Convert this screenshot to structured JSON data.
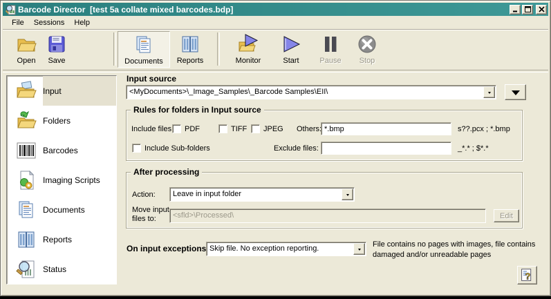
{
  "window": {
    "title": "Barcode Director  [test 5a collate mixed barcodes.bdp]",
    "app_icon": "barcode-magnifier-icon",
    "controls": {
      "minimize": "minimize-icon",
      "maximize": "maximize-icon",
      "close": "close-icon"
    }
  },
  "menu": {
    "items": [
      {
        "label": "File"
      },
      {
        "label": "Sessions"
      },
      {
        "label": "Help"
      }
    ]
  },
  "toolbar": {
    "items": [
      {
        "label": "Open",
        "icon": "open-folder-icon"
      },
      {
        "label": "Save",
        "icon": "save-floppy-icon"
      },
      {
        "label": "Documents",
        "icon": "documents-icon",
        "selected": true
      },
      {
        "label": "Reports",
        "icon": "reports-icon"
      },
      {
        "label": "Monitor",
        "icon": "monitor-icon"
      },
      {
        "label": "Start",
        "icon": "start-icon"
      },
      {
        "label": "Pause",
        "icon": "pause-icon",
        "disabled": true
      },
      {
        "label": "Stop",
        "icon": "stop-icon",
        "disabled": true
      }
    ]
  },
  "sidebar": {
    "items": [
      {
        "label": "Input",
        "icon": "input-folder-icon",
        "selected": true
      },
      {
        "label": "Folders",
        "icon": "folders-icon"
      },
      {
        "label": "Barcodes",
        "icon": "barcodes-icon"
      },
      {
        "label": "Imaging Scripts",
        "icon": "imaging-scripts-icon"
      },
      {
        "label": "Documents",
        "icon": "documents-icon"
      },
      {
        "label": "Reports",
        "icon": "reports-icon"
      },
      {
        "label": "Status",
        "icon": "status-icon"
      }
    ]
  },
  "main": {
    "input_source": {
      "label": "Input source",
      "value": "<MyDocuments>\\_Image_Samples\\_Barcode Samples\\EII\\"
    },
    "rules": {
      "title": "Rules for folders in Input source",
      "include_files_label": "Include files:",
      "file_types": [
        {
          "label": "PDF",
          "checked": false
        },
        {
          "label": "TIFF",
          "checked": false
        },
        {
          "label": "JPEG",
          "checked": false
        }
      ],
      "others_label": "Others:",
      "others_value": "*.bmp",
      "others_hint": "s??.pcx ; *.bmp",
      "include_subfolders_label": "Include Sub-folders",
      "include_subfolders_checked": false,
      "exclude_label": "Exclude files:",
      "exclude_value": "",
      "exclude_hint": "_*.* ; $*.*"
    },
    "after_processing": {
      "title": "After processing",
      "action_label": "Action:",
      "action_value": "Leave in input folder",
      "move_label_line1": "Move input",
      "move_label_line2": "files to:",
      "move_value": "<sfld>\\Processed\\",
      "edit_label": "Edit"
    },
    "exceptions": {
      "label": "On input exceptions:",
      "value": "Skip file. No exception reporting.",
      "hint_line1": "File contains no pages with images, file",
      "hint_line2": "contains damaged and/or unreadable pages"
    },
    "help_icon": "help-icon",
    "accent_colors": {
      "titlebar_teal": "#2A7F7E",
      "window_face": "#ECE9D8",
      "folder_yellow": "#E9BE4E",
      "play_purple": "#8585E8"
    }
  }
}
